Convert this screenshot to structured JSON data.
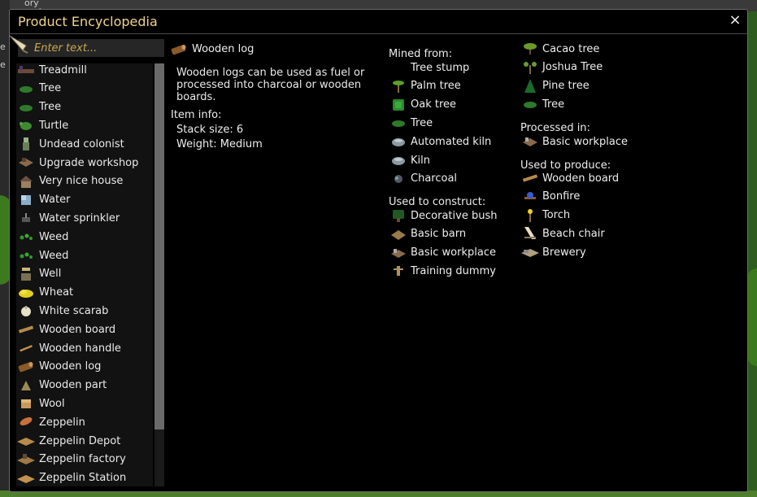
{
  "background": {
    "corner_text_1": "ory and add",
    "corner_text_2": "e",
    "corner_text_3": "e"
  },
  "window": {
    "title": "Product Encyclopedia",
    "close_glyph": "×"
  },
  "search": {
    "placeholder": "Enter text...",
    "value": ""
  },
  "list": {
    "items": [
      {
        "label": "Treadmill",
        "icon": "treadmill-icon"
      },
      {
        "label": "Tree",
        "icon": "tree-icon"
      },
      {
        "label": "Tree",
        "icon": "tree-icon"
      },
      {
        "label": "Turtle",
        "icon": "turtle-icon"
      },
      {
        "label": "Undead colonist",
        "icon": "undead-colonist-icon"
      },
      {
        "label": "Upgrade workshop",
        "icon": "workshop-icon"
      },
      {
        "label": "Very nice house",
        "icon": "house-icon"
      },
      {
        "label": "Water",
        "icon": "water-icon"
      },
      {
        "label": "Water sprinkler",
        "icon": "sprinkler-icon"
      },
      {
        "label": "Weed",
        "icon": "weed-icon"
      },
      {
        "label": "Weed",
        "icon": "weed-icon"
      },
      {
        "label": "Well",
        "icon": "well-icon"
      },
      {
        "label": "Wheat",
        "icon": "wheat-icon"
      },
      {
        "label": "White scarab",
        "icon": "scarab-icon"
      },
      {
        "label": "Wooden board",
        "icon": "board-icon"
      },
      {
        "label": "Wooden handle",
        "icon": "handle-icon"
      },
      {
        "label": "Wooden log",
        "icon": "log-icon"
      },
      {
        "label": "Wooden part",
        "icon": "part-icon"
      },
      {
        "label": "Wool",
        "icon": "wool-icon"
      },
      {
        "label": "Zeppelin",
        "icon": "zeppelin-icon"
      },
      {
        "label": "Zeppelin Depot",
        "icon": "depot-icon"
      },
      {
        "label": "Zeppelin factory",
        "icon": "factory-icon"
      },
      {
        "label": "Zeppelin Station",
        "icon": "station-icon"
      }
    ]
  },
  "detail": {
    "name": "Wooden log",
    "description": "Wooden logs can be used as fuel or processed into charcoal or wooden boards.",
    "info_heading": "Item info:",
    "stack_size": "Stack size: 6",
    "weight": "Weight: Medium"
  },
  "mined_from": {
    "heading": "Mined from:",
    "items": [
      {
        "label": "Tree stump",
        "icon": "tree-stump-icon"
      },
      {
        "label": "Palm tree",
        "icon": "palm-tree-icon"
      },
      {
        "label": "Oak tree",
        "icon": "oak-tree-icon"
      },
      {
        "label": "Tree",
        "icon": "tree-icon"
      },
      {
        "label": "Automated kiln",
        "icon": "kiln-icon"
      },
      {
        "label": "Kiln",
        "icon": "kiln-icon"
      },
      {
        "label": "Charcoal",
        "icon": "charcoal-icon"
      }
    ],
    "more": [
      {
        "label": "Cacao tree",
        "icon": "cacao-tree-icon"
      },
      {
        "label": "Joshua Tree",
        "icon": "joshua-tree-icon"
      },
      {
        "label": "Pine tree",
        "icon": "pine-tree-icon"
      },
      {
        "label": "Tree",
        "icon": "tree-icon"
      }
    ]
  },
  "used_to_construct": {
    "heading": "Used to construct:",
    "items": [
      {
        "label": "Decorative bush",
        "icon": "bush-icon"
      },
      {
        "label": "Basic barn",
        "icon": "barn-icon"
      },
      {
        "label": "Basic workplace",
        "icon": "workplace-icon"
      },
      {
        "label": "Training dummy",
        "icon": "dummy-icon"
      }
    ]
  },
  "processed_in": {
    "heading": "Processed in:",
    "items": [
      {
        "label": "Basic workplace",
        "icon": "workplace-icon"
      }
    ]
  },
  "used_to_produce": {
    "heading": "Used to produce:",
    "items": [
      {
        "label": "Wooden board",
        "icon": "board-icon"
      },
      {
        "label": "Bonfire",
        "icon": "bonfire-icon"
      },
      {
        "label": "Torch",
        "icon": "torch-icon"
      },
      {
        "label": "Beach chair",
        "icon": "chair-icon"
      },
      {
        "label": "Brewery",
        "icon": "brewery-icon"
      }
    ]
  },
  "colors": {
    "title": "#f0d48a",
    "placeholder": "#cba750",
    "panel_bg": "#000000",
    "list_bg": "#121212"
  }
}
